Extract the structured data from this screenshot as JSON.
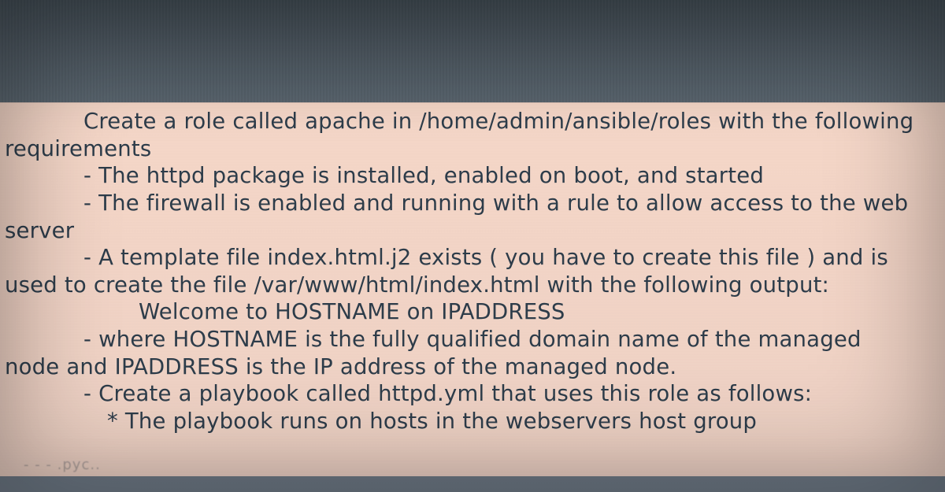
{
  "doc": {
    "l1": "Create a role called apache in /home/admin/ansible/roles with the following",
    "l2": "requirements",
    "l3": "- The httpd package is installed, enabled on boot, and started",
    "l4": "- The firewall is enabled and running with a rule to allow access to the web",
    "l5": "server",
    "l6": "- A template file index.html.j2 exists ( you have to create this file ) and is",
    "l7": "used to create the file /var/www/html/index.html with the following output:",
    "l8": "Welcome to HOSTNAME on IPADDRESS",
    "l9": "- where HOSTNAME is the fully qualified domain name of the managed",
    "l10": "node and IPADDRESS is the IP address of the managed node.",
    "l11": "- Create a playbook called httpd.yml that uses this role as follows:",
    "l12": "* The playbook runs on hosts in the webservers host group"
  },
  "footer_noise": "- - -  .pyc.."
}
